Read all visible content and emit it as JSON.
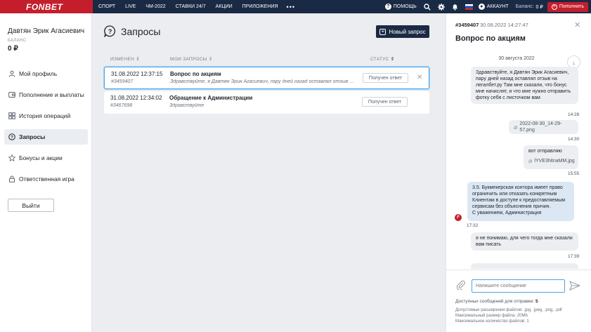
{
  "header": {
    "logo": "FONBET",
    "nav": [
      "СПОРТ",
      "LIVE",
      "ЧМ-2022",
      "СТАВКИ 24/7",
      "АКЦИИ",
      "ПРИЛОЖЕНИЯ"
    ],
    "more": "•••",
    "help": "ПОМОЩЬ",
    "account": "АККАУНТ",
    "balance_label": "Баланс:",
    "balance_value": "0 ₽",
    "topup": "Пополнить"
  },
  "sidebar": {
    "user_name": "Давтян Эрик Агасиевич",
    "balance_caption": "БАЛАНС",
    "balance_value": "0 ₽",
    "items": [
      {
        "label": "Мой профиль",
        "icon": "user-icon"
      },
      {
        "label": "Пополнение и выплаты",
        "icon": "wallet-icon"
      },
      {
        "label": "История операций",
        "icon": "grid-icon"
      },
      {
        "label": "Запросы",
        "icon": "question-icon"
      },
      {
        "label": "Бонусы и акции",
        "icon": "star-icon"
      },
      {
        "label": "Ответственная игра",
        "icon": "lock-icon"
      }
    ],
    "logout": "Выйти"
  },
  "main": {
    "title": "Запросы",
    "new_request": "Новый запрос",
    "columns": {
      "changed": "ИЗМЕНЕН",
      "my_requests": "МОИ ЗАПРОСЫ",
      "status": "СТАТУС"
    },
    "rows": [
      {
        "date": "31.08.2022 12:37:15",
        "id": "#3459407",
        "subject": "Вопрос по акциям",
        "preview": "Здравствуйте, я Давтян Эрик Агасиевич, пару дней назад оставлял отзыв на ле...",
        "status": "Получен ответ"
      },
      {
        "date": "31.08.2022 12:34:02",
        "id": "#3467698",
        "subject": "Обращение к Администрации",
        "preview": "Здравствуйте",
        "status": "Получен ответ"
      }
    ]
  },
  "chat": {
    "id": "#3459407",
    "date": "30.08.2022 14:27:47",
    "title": "Вопрос по акциям",
    "day": "30 августа 2022",
    "messages": [
      {
        "text": "Здравствуйте, я Давтян Эрик Агасиевич, пару дней назад оставлял отзыв на легалбет.ру Там мне сказали, что бонус мне начислят, и что мне нужно отправить фотку себя с листочком вам",
        "time": "14:28"
      },
      {
        "attachment": "2022-08-30_14-29-57.png",
        "time": "14:30"
      },
      {
        "text": "вот отправляю",
        "attachment": "lYVE3NtnaMM.jpg",
        "time": "15:55"
      },
      {
        "text": "3.5. Букмекерская контора имеет право ограничить или отказать конкретным Клиентам в доступе к предоставляемым сервисам без объяснения причин.",
        "signature": "С уважением, Администрация",
        "time": "17:32"
      },
      {
        "text": "я не понимаю, для чего тогда мне сказали вам писать",
        "time": "17:39"
      }
    ],
    "input_placeholder": "Напишите сообщение",
    "available_label": "Доступных сообщений для отправки:",
    "available_count": "5",
    "hint_ext": "Допустимые расширения файлов: .jpg, .jpeg, .png, .pdf",
    "hint_size": "Максимальный размер файла: 20Mb",
    "hint_count": "Максимальное количество файлов: 1"
  }
}
